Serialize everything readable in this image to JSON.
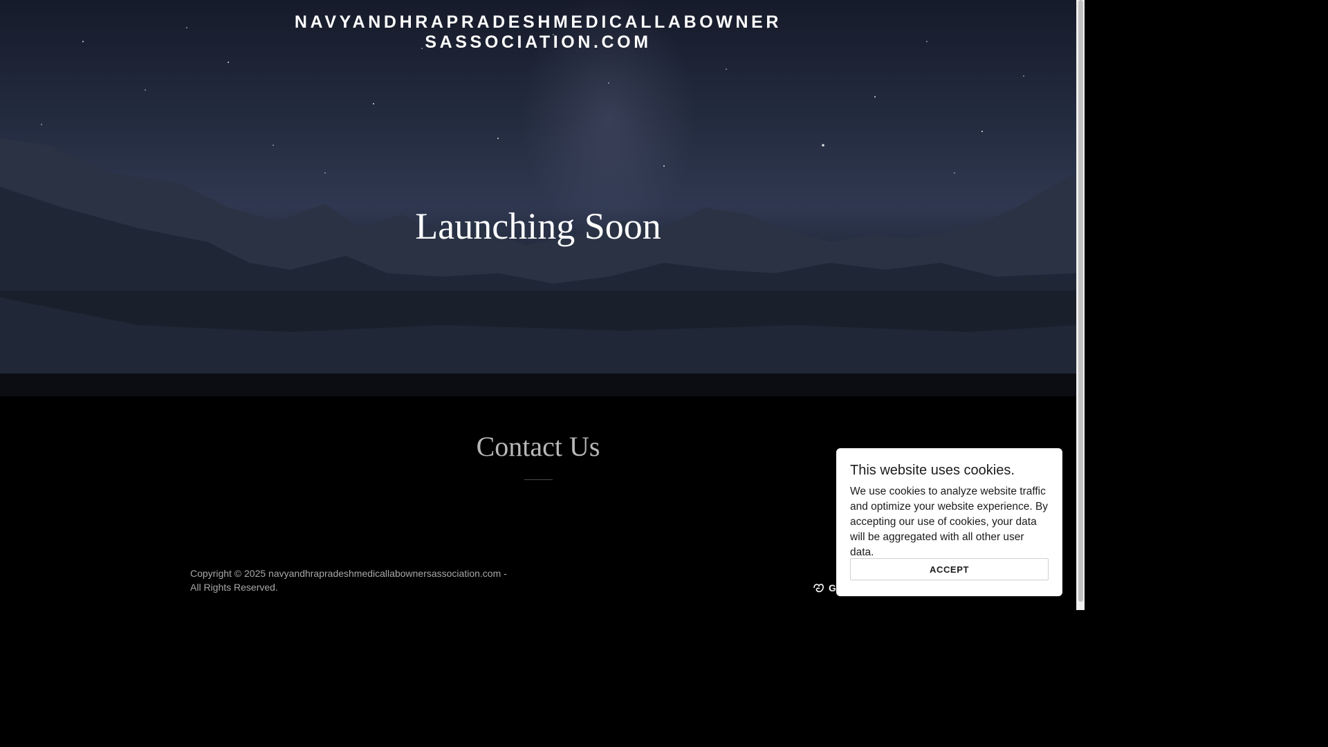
{
  "header": {
    "site_title": "NAVYANDHRAPRADESHMEDICALLABOWNERSASSOCIATION.COM"
  },
  "hero": {
    "heading": "Launching Soon"
  },
  "contact": {
    "heading": "Contact Us"
  },
  "footer": {
    "copyright": "Copyright © 2025 navyandhrapradeshmedicallabownersassociation.com - All Rights Reserved.",
    "powered_by": "Go"
  },
  "cookie_banner": {
    "title": "This website uses cookies.",
    "text": "We use cookies to analyze website traffic and optimize your website experience. By accepting our use of cookies, your data will be aggregated with all other user data.",
    "accept_label": "ACCEPT"
  }
}
